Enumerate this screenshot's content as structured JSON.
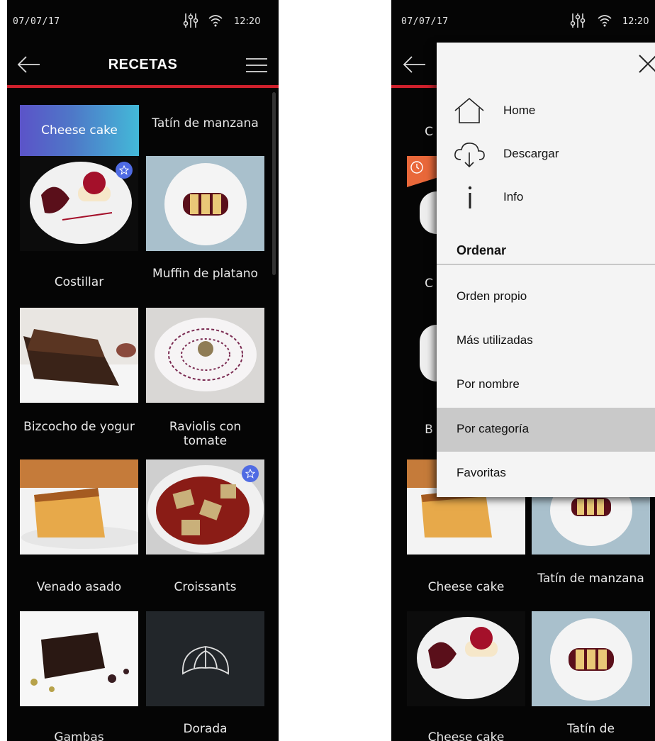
{
  "left": {
    "status": {
      "date": "07/07/17",
      "time": "12:20"
    },
    "title": "RECETAS",
    "grid": [
      {
        "label": "Cheese cake",
        "selected": true
      },
      {
        "label": "Tatín de manzana"
      },
      {
        "label": "Costillar"
      },
      {
        "label": "Muffin de platano"
      },
      {
        "label": "Bizcocho de yogur"
      },
      {
        "label": "Raviolis con tomate"
      },
      {
        "label": "Venado asado"
      },
      {
        "label": "Croissants"
      },
      {
        "label": "Gambas"
      },
      {
        "label": "Dorada"
      }
    ]
  },
  "right": {
    "status": {
      "date": "07/07/17",
      "time": "12:20"
    },
    "menu": {
      "items": [
        {
          "label": "Home",
          "icon": "home-icon"
        },
        {
          "label": "Descargar",
          "icon": "cloud-download-icon"
        },
        {
          "label": "Info",
          "icon": "info-icon"
        }
      ],
      "section": "Ordenar",
      "sort_options": [
        "Orden propio",
        "Más utilizadas",
        "Por nombre",
        "Por categoría",
        "Favoritas"
      ],
      "active_sort": "Por categoría"
    },
    "peek_labels": [
      "C",
      "C",
      "B"
    ],
    "bottom_grid": [
      {
        "label": "Cheese cake"
      },
      {
        "label": "Tatín de manzana"
      },
      {
        "label": "Cheese cake"
      },
      {
        "label": "Tatín de"
      }
    ]
  },
  "colors": {
    "accent": "#d0202c",
    "selected_from": "#5b53c8",
    "selected_to": "#43b9d8",
    "star": "#4f6be3",
    "clock_badge": "#e9683a"
  }
}
